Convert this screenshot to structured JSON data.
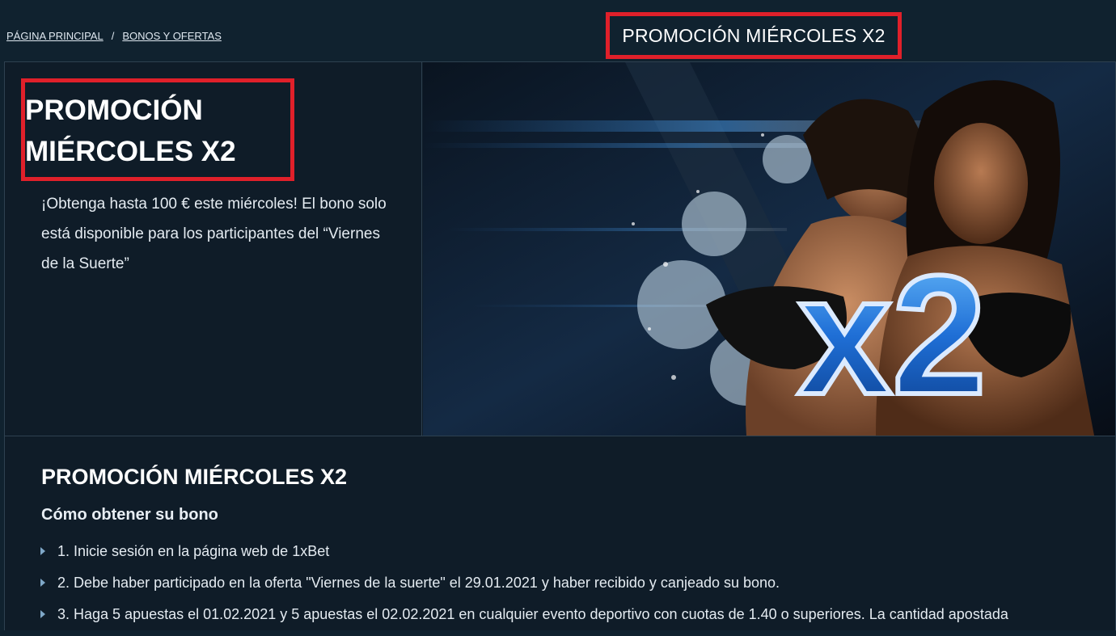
{
  "breadcrumb": {
    "home": "PÁGINA PRINCIPAL",
    "separator": "/",
    "section": "BONOS Y OFERTAS"
  },
  "page_title": "PROMOCIÓN MIÉRCOLES X2",
  "hero": {
    "title": "PROMOCIÓN MIÉRCOLES X2",
    "description": "¡Obtenga hasta 100 € este miércoles! El bono solo está disponible para los participantes del “Viernes de la Suerte”",
    "image_badge": "x2"
  },
  "content": {
    "title": "PROMOCIÓN MIÉRCOLES X2",
    "subtitle": "Cómo obtener su bono",
    "steps": [
      "1. Inicie sesión en la página web de 1xBet",
      "2. Debe haber participado en la oferta \"Viernes de la suerte\" el 29.01.2021 y haber recibido y canjeado su bono.",
      "3. Haga 5 apuestas el 01.02.2021 y 5 apuestas el 02.02.2021 en cualquier evento deportivo con cuotas de 1.40 o superiores. La cantidad apostada"
    ]
  },
  "colors": {
    "background": "#10222f",
    "panel": "#0f1c28",
    "highlight_border": "#e0202a",
    "badge_blue": "#1f6fd6"
  }
}
